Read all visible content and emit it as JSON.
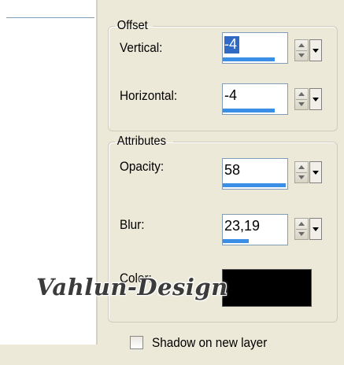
{
  "offset": {
    "legend": "Offset",
    "vertical": {
      "label": "Vertical:",
      "value": "-4",
      "slider_fraction": 0.8
    },
    "horizontal": {
      "label": "Horizontal:",
      "value": "-4",
      "slider_fraction": 0.8
    }
  },
  "attributes": {
    "legend": "Attributes",
    "opacity": {
      "label": "Opacity:",
      "value": "58",
      "slider_fraction": 0.97
    },
    "blur": {
      "label": "Blur:",
      "value": "23,19",
      "slider_fraction": 0.4
    },
    "color": {
      "label": "Color:",
      "value": "#000000"
    }
  },
  "shadow_on_new_layer": {
    "label": "Shadow on new layer",
    "checked": false
  },
  "watermark": {
    "text": "Vahlun-Design"
  },
  "icons": {
    "spinner": "spin-up-down-icon",
    "dropdown": "dropdown-arrow-icon"
  }
}
